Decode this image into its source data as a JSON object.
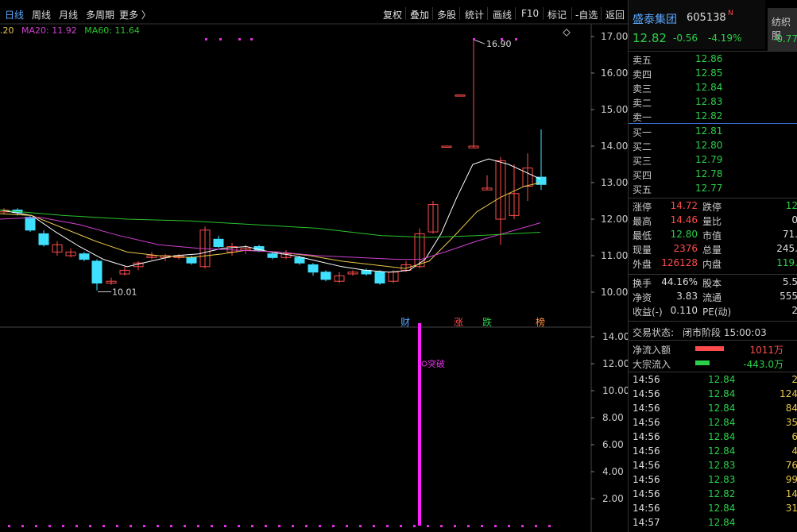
{
  "toolbar": {
    "periods": [
      "日线",
      "周线",
      "月线",
      "多周期",
      "更多 〉"
    ],
    "buttons": [
      "复权",
      "叠加",
      "多股",
      "统计",
      "画线",
      "F10",
      "标记",
      "-自选",
      "返回"
    ]
  },
  "ma_legend": {
    "ma10_label": ".20",
    "ma20_label": "MA20: 11.92",
    "ma60_label": "MA60: 11.64"
  },
  "main_chart": {
    "yaxis": [
      "17.00",
      "16.00",
      "15.00",
      "14.00",
      "13.00",
      "12.00",
      "11.00",
      "10.00"
    ],
    "high_annotation": "16.90",
    "low_annotation": "10.01",
    "event_labels": [
      {
        "text": "财",
        "color": "#5aa8ff"
      },
      {
        "text": "涨",
        "color": "#ff4b4b"
      },
      {
        "text": "跌",
        "color": "#2bd04a"
      },
      {
        "text": "榜",
        "color": "#ff8c3a"
      }
    ]
  },
  "sub_chart": {
    "yaxis": [
      "14.00",
      "12.00",
      "10.00",
      "8.00",
      "6.00",
      "4.00",
      "2.00"
    ],
    "breakout_label": "突破"
  },
  "stock": {
    "name": "盛泰集团",
    "code": "605138",
    "flag": "N",
    "price": "12.82",
    "change": "-0.56",
    "change_pct": "-4.19%",
    "side_name": "纺织服",
    "side_change": "-0.77"
  },
  "order_book": {
    "asks": [
      {
        "label": "卖五",
        "price": "12.86"
      },
      {
        "label": "卖四",
        "price": "12.85"
      },
      {
        "label": "卖三",
        "price": "12.84"
      },
      {
        "label": "卖二",
        "price": "12.83"
      },
      {
        "label": "卖一",
        "price": "12.82"
      }
    ],
    "bids": [
      {
        "label": "买一",
        "price": "12.81"
      },
      {
        "label": "买二",
        "price": "12.80"
      },
      {
        "label": "买三",
        "price": "12.79"
      },
      {
        "label": "买四",
        "price": "12.78"
      },
      {
        "label": "买五",
        "price": "12.77"
      }
    ]
  },
  "stats": [
    {
      "l1": "涨停",
      "v1": "14.72",
      "c1": "up",
      "l2": "跌停",
      "v2": "12",
      "c2": "dn"
    },
    {
      "l1": "最高",
      "v1": "14.46",
      "c1": "up",
      "l2": "量比",
      "v2": "0",
      "c2": "wh"
    },
    {
      "l1": "最低",
      "v1": "12.80",
      "c1": "dn",
      "l2": "市值",
      "v2": "71.",
      "c2": "wh"
    },
    {
      "l1": "现量",
      "v1": "2376",
      "c1": "up",
      "l2": "总量",
      "v2": "245.",
      "c2": "wh"
    },
    {
      "l1": "外盘",
      "v1": "126128",
      "c1": "up",
      "l2": "内盘",
      "v2": "119.",
      "c2": "dn"
    }
  ],
  "stats2": [
    {
      "l1": "换手",
      "v1": "44.16%",
      "l2": "股本",
      "v2": "5.5"
    },
    {
      "l1": "净资",
      "v1": "3.83",
      "l2": "流通",
      "v2": "555"
    },
    {
      "l1": "收益(-)",
      "v1": "0.110",
      "l2": "PE(动)",
      "v2": "2"
    }
  ],
  "trade_status": {
    "label": "交易状态:",
    "value": "闭市阶段 15:00:03"
  },
  "flows": [
    {
      "label": "净流入额",
      "value": "1011万",
      "color": "#ff4b4b",
      "bar": 0.6
    },
    {
      "label": "大宗流入",
      "value": "-443.0万",
      "color": "#2bd04a",
      "bar": 0.3
    }
  ],
  "ticks": [
    {
      "time": "14:56",
      "price": "12.84",
      "vol": "2",
      "c": "up"
    },
    {
      "time": "14:56",
      "price": "12.84",
      "vol": "124",
      "c": "up"
    },
    {
      "time": "14:56",
      "price": "12.84",
      "vol": "84",
      "c": "up"
    },
    {
      "time": "14:56",
      "price": "12.84",
      "vol": "35",
      "c": "up"
    },
    {
      "time": "14:56",
      "price": "12.84",
      "vol": "6",
      "c": "up"
    },
    {
      "time": "14:56",
      "price": "12.84",
      "vol": "4",
      "c": "up"
    },
    {
      "time": "14:56",
      "price": "12.83",
      "vol": "76",
      "c": "up"
    },
    {
      "time": "14:56",
      "price": "12.83",
      "vol": "99",
      "c": "up"
    },
    {
      "time": "14:56",
      "price": "12.82",
      "vol": "14",
      "c": "up"
    },
    {
      "time": "14:56",
      "price": "12.84",
      "vol": "31",
      "c": "up"
    },
    {
      "time": "14:57",
      "price": "12.84",
      "vol": "",
      "c": "up"
    }
  ],
  "colors": {
    "up": "#ff4b4b",
    "down": "#3fe0ff",
    "ma5": "#ffffff",
    "ma10": "#e8c84a",
    "ma20": "#d040d0",
    "ma60": "#2bc42b",
    "accent": "#5aa8ff",
    "vol_bar": "#ff20ff"
  }
}
